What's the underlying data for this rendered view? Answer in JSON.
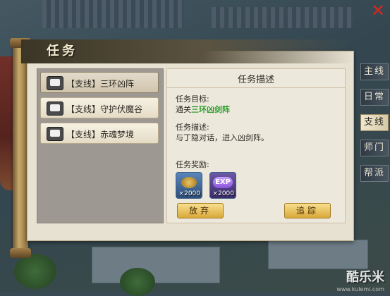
{
  "window": {
    "title": "任务"
  },
  "close": {
    "label": "✕"
  },
  "quest_list": {
    "items": [
      {
        "label": "【支线】三环凶阵"
      },
      {
        "label": "【支线】守护伏魔谷"
      },
      {
        "label": "【支线】赤魂梦境"
      }
    ]
  },
  "description": {
    "header": "任务描述",
    "target_label": "任务目标:",
    "target_prefix": "通关",
    "target_highlight": "三环凶剑阵",
    "desc_label": "任务描述:",
    "desc_text": "与丁隐对话，进入凶剑阵。",
    "reward_label": "任务奖励:",
    "rewards": [
      {
        "name": "coin",
        "count": "×2000"
      },
      {
        "name": "exp",
        "badge": "EXP",
        "count": "×2000"
      }
    ],
    "abandon_label": "放弃",
    "track_label": "追踪"
  },
  "side_tabs": [
    {
      "label": "主线"
    },
    {
      "label": "日常"
    },
    {
      "label": "支线"
    },
    {
      "label": "师门"
    },
    {
      "label": "帮派"
    }
  ],
  "watermark": {
    "text": "酷乐米",
    "sub": "www.kulemi.com"
  },
  "colors": {
    "highlight": "#2e9e2e",
    "close": "#d8281f",
    "button": "#e8c05a"
  }
}
